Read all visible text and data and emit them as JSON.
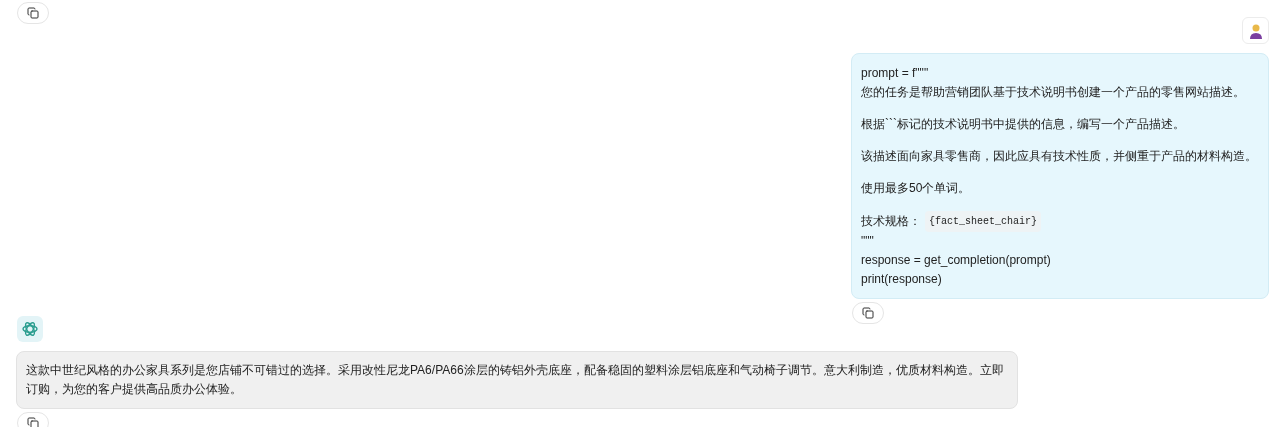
{
  "user_message": {
    "blocks": [
      {
        "kind": "line",
        "text": "prompt = f\"\"\""
      },
      {
        "kind": "line",
        "text": "您的任务是帮助营销团队基于技术说明书创建一个产品的零售网站描述。"
      },
      {
        "kind": "paragraph",
        "text": "根据```标记的技术说明书中提供的信息，编写一个产品描述。"
      },
      {
        "kind": "paragraph",
        "text": "该描述面向家具零售商，因此应具有技术性质，并侧重于产品的材料构造。"
      },
      {
        "kind": "paragraph",
        "text": "使用最多50个单词。"
      },
      {
        "kind": "code_line",
        "text": "技术规格：",
        "code": "{fact_sheet_chair}"
      },
      {
        "kind": "line",
        "text": "\"\"\""
      },
      {
        "kind": "line",
        "text": "response = get_completion(prompt)"
      },
      {
        "kind": "line",
        "text": "print(response)"
      }
    ]
  },
  "assistant_message": {
    "text": "这款中世纪风格的办公家具系列是您店铺不可错过的选择。采用改性尼龙PA6/PA66涂层的铸铝外壳底座，配备稳固的塑料涂层铝底座和气动椅子调节。意大利制造，优质材料构造。立即订购，为您的客户提供高品质办公体验。"
  }
}
